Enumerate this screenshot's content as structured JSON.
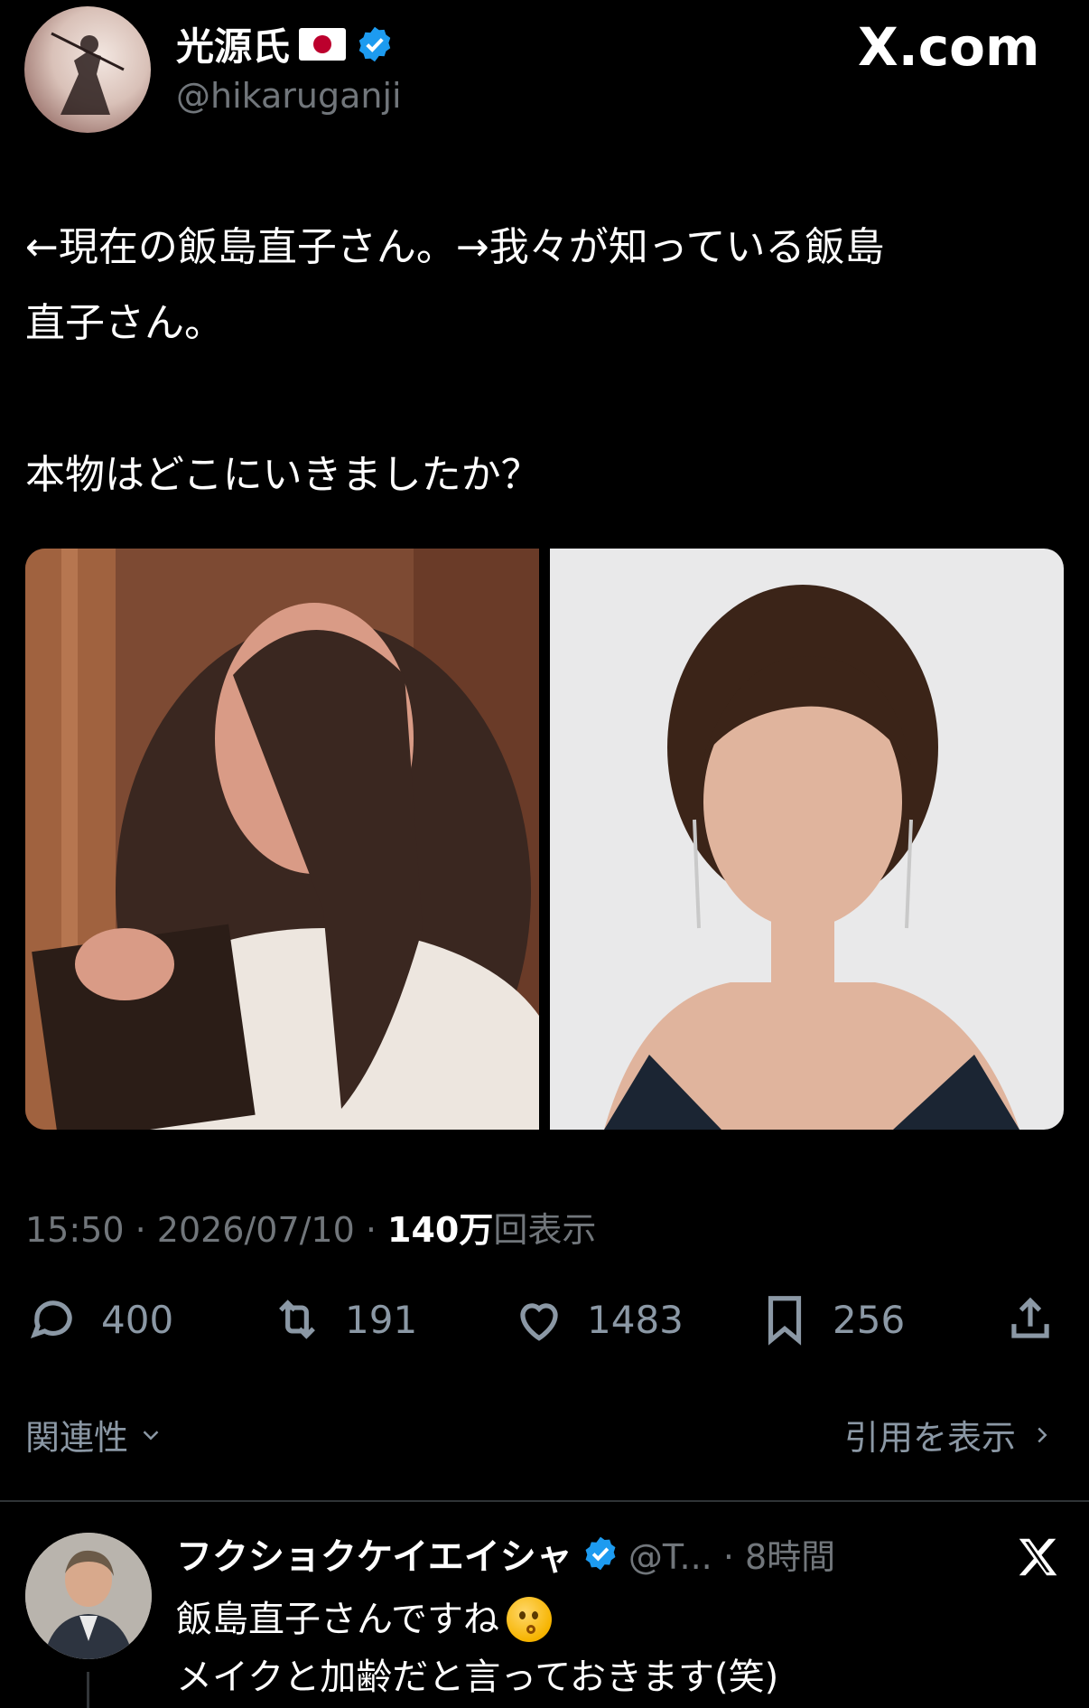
{
  "colors": {
    "background": "#000000",
    "text": "#e7e9ea",
    "muted": "#71767b",
    "verified_blue": "#1d9bf0",
    "flag_red": "#bc002d"
  },
  "author": {
    "display_name": "光源氏",
    "handle": "@hikaruganji",
    "flag_icon": "japan-flag-icon",
    "verified_icon": "verified-badge-icon"
  },
  "watermark": "X.com",
  "tweet": {
    "line1": "←現在の飯島直子さん。→我々が知っている飯島",
    "line2": "直子さん。",
    "line3": "本物はどこにいきましたか？"
  },
  "media": {
    "images": [
      {
        "alt_icon": "photo-left"
      },
      {
        "alt_icon": "photo-right"
      }
    ]
  },
  "meta": {
    "time": "15:50",
    "sep1": " · ",
    "date": "2026/07/10",
    "sep2": " · ",
    "views_count": "140万",
    "views_label": "回表示"
  },
  "actions": {
    "replies": "400",
    "retweets": "191",
    "likes": "1483",
    "bookmarks": "256"
  },
  "sort": {
    "relevance_label": "関連性",
    "quotes_label": "引用を表示"
  },
  "reply": {
    "name": "フクショクケイエイシャ",
    "handle_time": "@T... · 8時間",
    "line1": "飯島直子さんですね",
    "line2": "メイクと加齢だと言っておきます(笑)"
  }
}
